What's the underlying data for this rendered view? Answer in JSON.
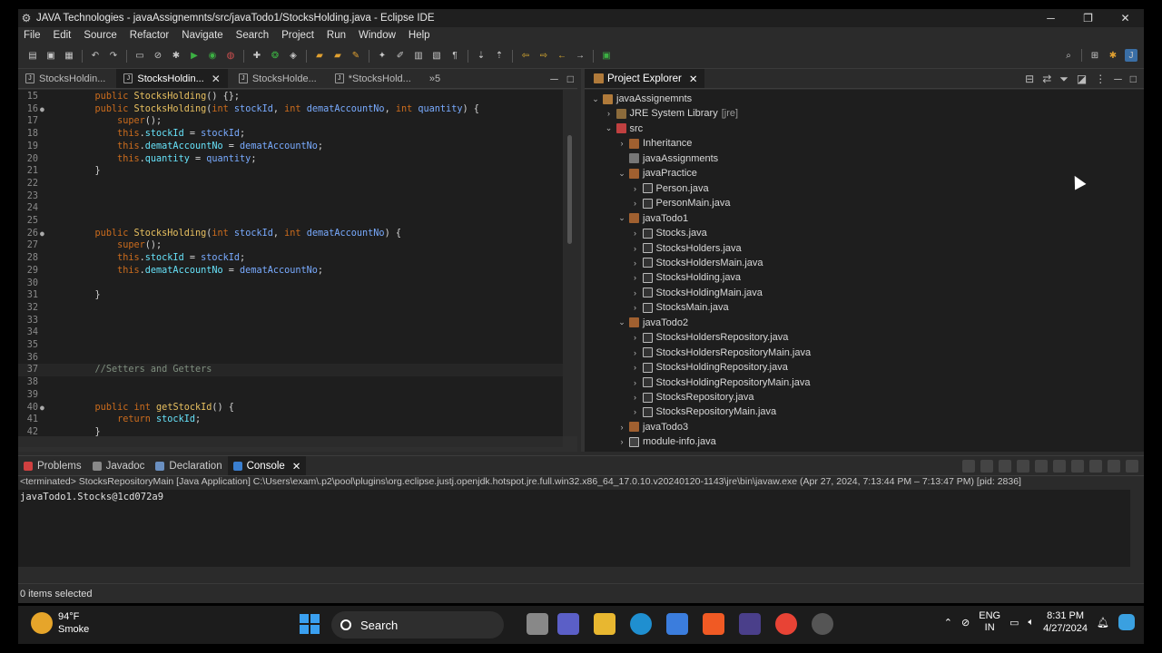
{
  "window": {
    "title": "JAVA Technologies - javaAssignemnts/src/javaTodo1/StocksHolding.java - Eclipse IDE",
    "minimize": "─",
    "restore": "❐",
    "close": "✕"
  },
  "menu": [
    "File",
    "Edit",
    "Source",
    "Refactor",
    "Navigate",
    "Search",
    "Project",
    "Run",
    "Window",
    "Help"
  ],
  "editor": {
    "tabs": [
      {
        "label": "StocksHoldin...",
        "active": false
      },
      {
        "label": "StocksHoldin...",
        "active": true
      },
      {
        "label": "StocksHolde...",
        "active": false
      },
      {
        "label": "*StocksHold...",
        "active": false
      },
      {
        "label": "»5",
        "active": false
      }
    ],
    "lines": [
      {
        "n": "15",
        "fold": "",
        "html": "    <span class='kw'>public</span> <span class='fn'>StocksHolding</span>() {};"
      },
      {
        "n": "16",
        "fold": "●",
        "html": "    <span class='kw'>public</span> <span class='fn'>StocksHolding</span>(<span class='kw'>int</span> <span class='par'>stockId</span>, <span class='kw'>int</span> <span class='par'>dematAccountNo</span>, <span class='kw'>int</span> <span class='par'>quantity</span>) {"
      },
      {
        "n": "17",
        "fold": "",
        "html": "        <span class='kw'>super</span>();"
      },
      {
        "n": "18",
        "fold": "",
        "html": "        <span class='thisc'>this</span>.<span class='fld'>stockId</span> = <span class='par'>stockId</span>;"
      },
      {
        "n": "19",
        "fold": "",
        "html": "        <span class='thisc'>this</span>.<span class='fld'>dematAccountNo</span> = <span class='par'>dematAccountNo</span>;"
      },
      {
        "n": "20",
        "fold": "",
        "html": "        <span class='thisc'>this</span>.<span class='fld'>quantity</span> = <span class='par'>quantity</span>;"
      },
      {
        "n": "21",
        "fold": "",
        "html": "    }"
      },
      {
        "n": "22",
        "fold": "",
        "html": ""
      },
      {
        "n": "23",
        "fold": "",
        "html": ""
      },
      {
        "n": "24",
        "fold": "",
        "html": ""
      },
      {
        "n": "25",
        "fold": "",
        "html": ""
      },
      {
        "n": "26",
        "fold": "●",
        "html": "    <span class='kw'>public</span> <span class='fn'>StocksHolding</span>(<span class='kw'>int</span> <span class='par'>stockId</span>, <span class='kw'>int</span> <span class='par'>dematAccountNo</span>) {"
      },
      {
        "n": "27",
        "fold": "",
        "html": "        <span class='kw'>super</span>();"
      },
      {
        "n": "28",
        "fold": "",
        "html": "        <span class='thisc'>this</span>.<span class='fld'>stockId</span> = <span class='par'>stockId</span>;"
      },
      {
        "n": "29",
        "fold": "",
        "html": "        <span class='thisc'>this</span>.<span class='fld'>dematAccountNo</span> = <span class='par'>dematAccountNo</span>;"
      },
      {
        "n": "30",
        "fold": "",
        "html": ""
      },
      {
        "n": "31",
        "fold": "",
        "html": "    }"
      },
      {
        "n": "32",
        "fold": "",
        "html": ""
      },
      {
        "n": "33",
        "fold": "",
        "html": ""
      },
      {
        "n": "34",
        "fold": "",
        "html": ""
      },
      {
        "n": "35",
        "fold": "",
        "html": ""
      },
      {
        "n": "36",
        "fold": "",
        "html": ""
      },
      {
        "n": "37",
        "fold": "",
        "html": "    <span class='cm'>//Setters and Getters</span>"
      },
      {
        "n": "38",
        "fold": "",
        "html": ""
      },
      {
        "n": "39",
        "fold": "",
        "html": ""
      },
      {
        "n": "40",
        "fold": "●",
        "html": "    <span class='kw'>public</span> <span class='kw'>int</span> <span class='fn'>getStockId</span>() {"
      },
      {
        "n": "41",
        "fold": "",
        "html": "        <span class='kw'>return</span> <span class='fld'>stockId</span>;"
      },
      {
        "n": "42",
        "fold": "",
        "html": "    }"
      }
    ]
  },
  "explorer": {
    "tab": "Project Explorer",
    "nodes": [
      {
        "depth": 0,
        "arrow": "⌄",
        "icon": "i-proj",
        "label": "javaAssignemnts",
        "suffix": ""
      },
      {
        "depth": 1,
        "arrow": "›",
        "icon": "i-lib",
        "label": "JRE System Library",
        "suffix": "[jre]"
      },
      {
        "depth": 1,
        "arrow": "⌄",
        "icon": "i-src",
        "label": "src",
        "suffix": ""
      },
      {
        "depth": 2,
        "arrow": "›",
        "icon": "i-pkg",
        "label": "Inheritance",
        "suffix": ""
      },
      {
        "depth": 2,
        "arrow": "",
        "icon": "i-pkgempty",
        "label": "javaAssignments",
        "suffix": ""
      },
      {
        "depth": 2,
        "arrow": "⌄",
        "icon": "i-pkg",
        "label": "javaPractice",
        "suffix": ""
      },
      {
        "depth": 3,
        "arrow": "›",
        "icon": "i-java",
        "label": "Person.java",
        "suffix": ""
      },
      {
        "depth": 3,
        "arrow": "›",
        "icon": "i-java",
        "label": "PersonMain.java",
        "suffix": ""
      },
      {
        "depth": 2,
        "arrow": "⌄",
        "icon": "i-pkg",
        "label": "javaTodo1",
        "suffix": ""
      },
      {
        "depth": 3,
        "arrow": "›",
        "icon": "i-java",
        "label": "Stocks.java",
        "suffix": ""
      },
      {
        "depth": 3,
        "arrow": "›",
        "icon": "i-java",
        "label": "StocksHolders.java",
        "suffix": ""
      },
      {
        "depth": 3,
        "arrow": "›",
        "icon": "i-java",
        "label": "StocksHoldersMain.java",
        "suffix": ""
      },
      {
        "depth": 3,
        "arrow": "›",
        "icon": "i-java",
        "label": "StocksHolding.java",
        "suffix": ""
      },
      {
        "depth": 3,
        "arrow": "›",
        "icon": "i-java",
        "label": "StocksHoldingMain.java",
        "suffix": ""
      },
      {
        "depth": 3,
        "arrow": "›",
        "icon": "i-java",
        "label": "StocksMain.java",
        "suffix": ""
      },
      {
        "depth": 2,
        "arrow": "⌄",
        "icon": "i-pkg",
        "label": "javaTodo2",
        "suffix": ""
      },
      {
        "depth": 3,
        "arrow": "›",
        "icon": "i-java",
        "label": "StocksHoldersRepository.java",
        "suffix": ""
      },
      {
        "depth": 3,
        "arrow": "›",
        "icon": "i-java",
        "label": "StocksHoldersRepositoryMain.java",
        "suffix": ""
      },
      {
        "depth": 3,
        "arrow": "›",
        "icon": "i-java",
        "label": "StocksHoldingRepository.java",
        "suffix": ""
      },
      {
        "depth": 3,
        "arrow": "›",
        "icon": "i-java",
        "label": "StocksHoldingRepositoryMain.java",
        "suffix": ""
      },
      {
        "depth": 3,
        "arrow": "›",
        "icon": "i-java",
        "label": "StocksRepository.java",
        "suffix": ""
      },
      {
        "depth": 3,
        "arrow": "›",
        "icon": "i-java",
        "label": "StocksRepositoryMain.java",
        "suffix": ""
      },
      {
        "depth": 2,
        "arrow": "›",
        "icon": "i-pkg",
        "label": "javaTodo3",
        "suffix": ""
      },
      {
        "depth": 2,
        "arrow": "›",
        "icon": "i-mod",
        "label": "module-info.java",
        "suffix": ""
      }
    ]
  },
  "bottom": {
    "tabs": [
      {
        "label": "Problems",
        "color": "#d04040",
        "active": false
      },
      {
        "label": "Javadoc",
        "color": "#888888",
        "active": false
      },
      {
        "label": "Declaration",
        "color": "#6a8fc0",
        "active": false
      },
      {
        "label": "Console",
        "color": "#3a7fd0",
        "active": true
      }
    ],
    "terminated": "<terminated> StocksRepositoryMain [Java Application] C:\\Users\\exam\\.p2\\pool\\plugins\\org.eclipse.justj.openjdk.hotspot.jre.full.win32.x86_64_17.0.10.v20240120-1143\\jre\\bin\\javaw.exe (Apr 27, 2024, 7:13:44 PM – 7:13:47 PM) [pid: 2836]",
    "output": "javaTodo1.Stocks@1cd072a9"
  },
  "status": {
    "text": "0 items selected"
  },
  "taskbar": {
    "temp": "94°F",
    "weather": "Smoke",
    "search": "Search",
    "lang1": "ENG",
    "lang2": "IN",
    "time": "8:31 PM",
    "date": "4/27/2024"
  }
}
